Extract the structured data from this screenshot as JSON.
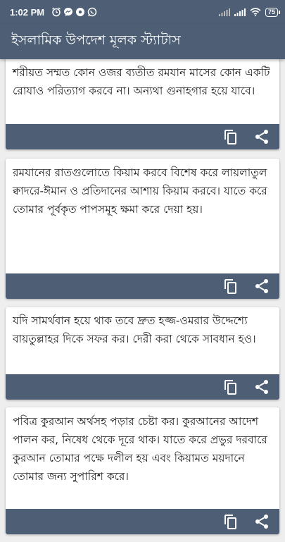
{
  "status_bar": {
    "time": "1:02 PM",
    "battery": "75"
  },
  "app_bar": {
    "title": "ইসলামিক উপদেশ মূলক স্ট্যাটাস"
  },
  "cards": [
    {
      "text": " শরীয়ত সম্মত কোন ওজর ব্যতীত রমযান মাসের কোন একটি রোযাও পরিত্যাগ করবে না। অন্যথা গুনাহগার হয়ে যাবে।"
    },
    {
      "text": "রমযানের রাতগুলোতে কিয়াম করবে বিশেষ করে লায়লাতুল ক্বাদরে-ঈমান ও প্রতিদানের আশায় কিয়াম করবে। যাতে করে তোমার পূর্বকৃত পাপসমূহ ক্ষমা করে দেয়া হয়।"
    },
    {
      "text": " যদি সামর্থবান হয়ে থাক তবে দ্রুত হজ্জ-ওমরার উদ্দেশ্যে বায়তুল্লাহর দিকে সফর কর। দেরী করা থেকে সাবধান হও।"
    },
    {
      "text": "পবিত্র কুরআন অর্থসহ পড়ার চেষ্টা কর। কুরআনের আদেশ পালন কর, নিষেধ থেকে দূরে থাক। যাতে করে প্রভুর দরবারে কুরআন তোমার পক্ষে দলীল হয় এবং কিয়ামত ময়দানে তোমার জন্য সুপারিশ করে।"
    }
  ],
  "colors": {
    "primary": "#4d5e75",
    "background": "#eeeeee",
    "card": "#ffffff"
  },
  "icons": [
    "alarm-icon",
    "messenger-icon",
    "settings-icon",
    "whatsapp-icon",
    "signal-icon",
    "wifi-icon",
    "copy-icon",
    "share-icon"
  ]
}
